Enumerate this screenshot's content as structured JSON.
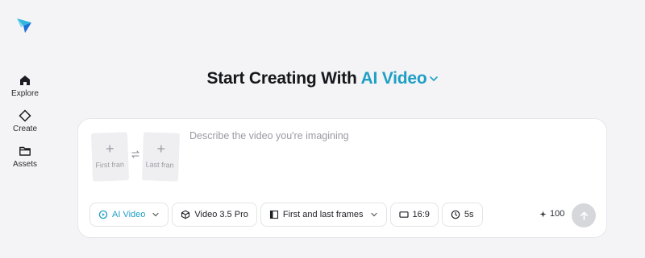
{
  "sidebar": {
    "items": [
      {
        "label": "Explore",
        "icon": "home-icon"
      },
      {
        "label": "Create",
        "icon": "diamond-icon"
      },
      {
        "label": "Assets",
        "icon": "folder-icon"
      }
    ]
  },
  "headline": {
    "prefix": "Start Creating With",
    "mode": "AI Video"
  },
  "composer": {
    "first_frame_label": "First fran",
    "last_frame_label": "Last fran",
    "prompt_placeholder": "Describe the video you're imagining",
    "chips": {
      "mode": "AI Video",
      "model": "Video 3.5 Pro",
      "frames": "First and last frames",
      "aspect": "16:9",
      "duration": "5s"
    },
    "credits": "100"
  },
  "colors": {
    "accent": "#1f9fc4",
    "background": "#f4f4f6",
    "submit_disabled": "#d6d7db"
  }
}
